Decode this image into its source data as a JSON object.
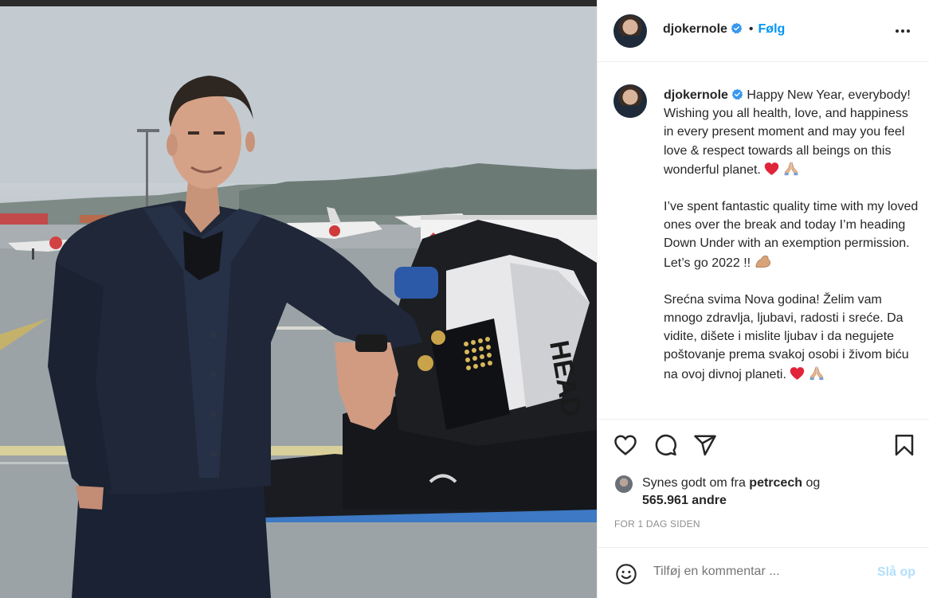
{
  "post": {
    "username": "djokernole",
    "follow_label": "Følg",
    "separator": "•",
    "caption_paragraphs": [
      "Happy New Year, everybody! Wishing you all health, love, and happiness in every present moment and may you feel love & respect towards all beings on this wonderful planet.",
      "I’ve spent fantastic quality time with my loved ones over the break and today I’m heading Down Under with an exemption permission. Let’s go 2022 !!",
      "Srećna svima Nova godina! Želim vam mnogo zdravlja, ljubavi, radosti i sreće. Da vidite, dišete i mislite ljubav i da negujete poštovanje prema svakoj osobi i živom biću na ovoj divnoj planeti."
    ],
    "emojis": [
      "red-heart-emoji",
      "folded-hands-emoji",
      "flexed-biceps-emoji"
    ]
  },
  "likes": {
    "prefix": "Synes godt om fra",
    "user": "petrcech",
    "joiner": "og",
    "count": "565.961 andre"
  },
  "timestamp": "FOR 1 DAG SIDEN",
  "comment": {
    "placeholder": "Tilføj en kommentar ...",
    "post_label": "Slå op"
  },
  "icons": [
    "more-options-icon",
    "heart-icon",
    "comment-icon",
    "share-icon",
    "bookmark-icon",
    "emoji-icon",
    "verified-badge-icon"
  ],
  "colors": {
    "link": "#0095f6",
    "post_disabled": "#b2dffc",
    "muted": "#8e8e8e",
    "text": "#262626",
    "verified": "#3897f0",
    "heart": "#e0243a"
  }
}
